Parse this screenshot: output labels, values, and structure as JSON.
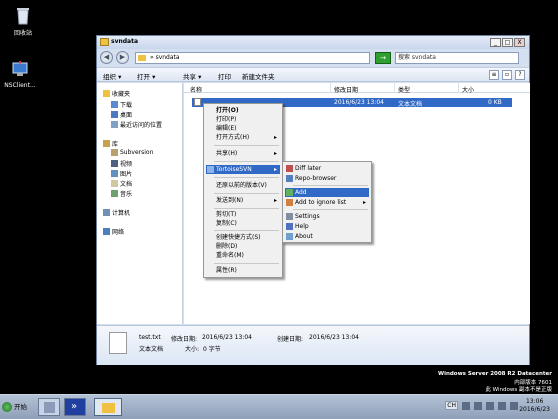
{
  "desktop": {
    "icons": [
      {
        "label": "回收站"
      },
      {
        "label": "NSClient..."
      }
    ],
    "watermark": {
      "line1": "Windows Server 2008 R2 Datacenter",
      "line2": "内部版本 7601",
      "line3": "此 Windows 副本不是正版"
    }
  },
  "window": {
    "title": "svndata",
    "controls": {
      "minimize": "_",
      "maximize": "□",
      "close": "X"
    },
    "address": {
      "path": "» svndata",
      "go": "→"
    },
    "search": {
      "placeholder": "搜索 svndata"
    },
    "toolbar": {
      "organize": "组织 ▾",
      "open": "打开 ▾",
      "share": "共享 ▾",
      "print": "打印",
      "new_folder": "新建文件夹"
    },
    "nav": {
      "favorites": "收藏夹",
      "downloads": "下载",
      "desktop": "桌面",
      "recent": "最近访问的位置",
      "libraries": "库",
      "subversion": "Subversion",
      "videos": "视频",
      "pictures": "图片",
      "documents": "文档",
      "music": "音乐",
      "computer": "计算机",
      "network": "网络"
    },
    "columns": {
      "name": "名称",
      "modified": "修改日期",
      "type": "类型",
      "size": "大小"
    },
    "file": {
      "name": "test.txt",
      "modified": "2016/6/23 13:04",
      "type": "文本文档",
      "size": "0 KB"
    },
    "details": {
      "filename": "test.txt",
      "modified_label": "修改日期:",
      "modified_value": "2016/6/23 13:04",
      "created_label": "创建日期:",
      "created_value": "2016/6/23 13:04",
      "type": "文本文档",
      "size_label": "大小:",
      "size_value": "0 字节"
    }
  },
  "context_menu": {
    "open": "打开(O)",
    "print": "打印(P)",
    "edit": "编辑(E)",
    "open_with": "打开方式(H)",
    "share": "共享(H)",
    "tortoisesvn": "TortoiseSVN",
    "restore": "还原以前的版本(V)",
    "send_to": "发送到(N)",
    "cut": "剪切(T)",
    "copy": "复制(C)",
    "create_shortcut": "创建快捷方式(S)",
    "delete": "删除(D)",
    "rename": "重命名(M)",
    "properties": "属性(R)"
  },
  "submenu": {
    "diff_later": "Diff later",
    "repo_browser": "Repo-browser",
    "add": "Add",
    "add_ignore": "Add to ignore list",
    "settings": "Settings",
    "help": "Help",
    "about": "About"
  },
  "taskbar": {
    "start": "开始",
    "lang": "CH",
    "time": "13:06",
    "date": "2016/6/23"
  }
}
